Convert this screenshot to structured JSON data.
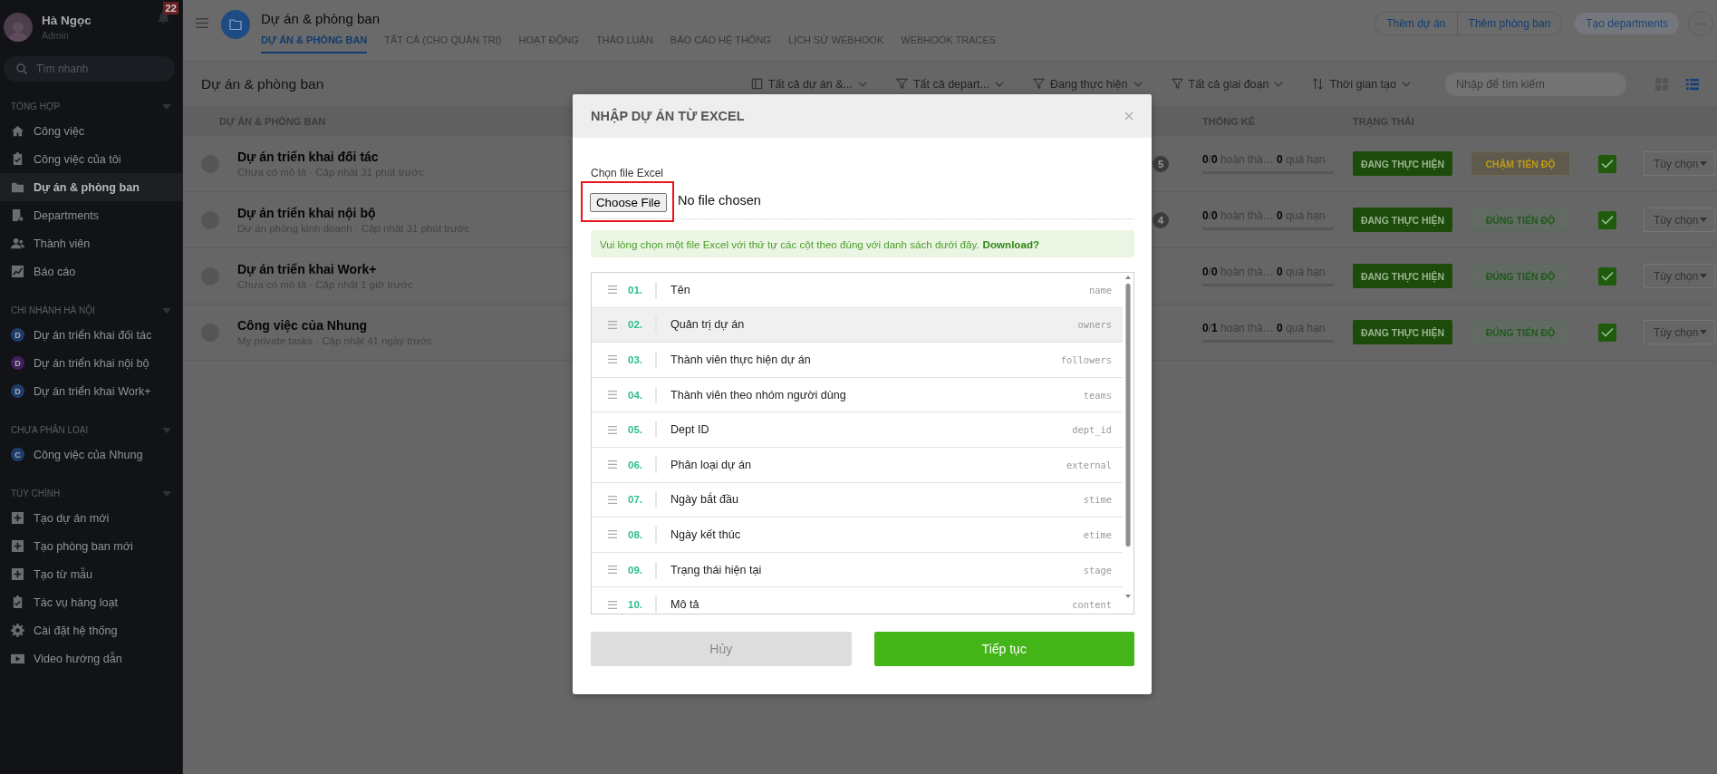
{
  "sidebar": {
    "user": {
      "name": "Hà Ngọc",
      "role": "Admin"
    },
    "notification_count": "22",
    "search": {
      "placeholder": "Tìm nhanh"
    },
    "sections": [
      {
        "title": "TỔNG HỢP",
        "expanded": true,
        "items": [
          {
            "label": "Công việc",
            "kind": "link",
            "selected": false
          },
          {
            "label": "Công việc của tôi",
            "kind": "link",
            "selected": false
          },
          {
            "label": "Dự án & phòng ban",
            "kind": "link",
            "selected": true
          },
          {
            "label": "Departments",
            "kind": "link",
            "selected": false
          },
          {
            "label": "Thành viên",
            "kind": "link",
            "selected": false
          },
          {
            "label": "Báo cáo",
            "kind": "link",
            "selected": false
          }
        ]
      },
      {
        "title": "CHI NHÁNH HÀ NỘI",
        "expanded": true,
        "items": [
          {
            "label": "Dự án triển khai đối tác",
            "kind": "project",
            "badge": "D",
            "color": "#1d3e6b",
            "selected": false
          },
          {
            "label": "Dự án triển khai nội bộ",
            "kind": "project",
            "badge": "D",
            "color": "#43205c",
            "selected": false
          },
          {
            "label": "Dự án triển khai Work+",
            "kind": "project",
            "badge": "D",
            "color": "#1d3e6b",
            "selected": false
          }
        ]
      },
      {
        "title": "CHƯA PHÂN LOẠI",
        "expanded": true,
        "items": [
          {
            "label": "Công việc của Nhung",
            "kind": "project",
            "badge": "C",
            "color": "#1d3e6b",
            "selected": false
          }
        ]
      },
      {
        "title": "TÙY CHỈNH",
        "expanded": true,
        "items": [
          {
            "label": "Tạo dự án mới",
            "kind": "link",
            "selected": false
          },
          {
            "label": "Tạo phòng ban mới",
            "kind": "link",
            "selected": false
          },
          {
            "label": "Tạo từ mẫu",
            "kind": "link",
            "selected": false
          },
          {
            "label": "Tác vụ hàng loạt",
            "kind": "link",
            "selected": false
          },
          {
            "label": "Cài đặt hệ thống",
            "kind": "link",
            "selected": false
          },
          {
            "label": "Video hướng dẫn",
            "kind": "link",
            "selected": false
          }
        ]
      }
    ]
  },
  "header": {
    "title": "Dự án & phòng ban",
    "tabs": [
      {
        "label": "DỰ ÁN & PHÒNG BAN",
        "selected": true
      },
      {
        "label": "TẤT CẢ (CHO QUẢN TRỊ)",
        "selected": false
      },
      {
        "label": "HOẠT ĐỘNG",
        "selected": false
      },
      {
        "label": "THẢO LUẬN",
        "selected": false
      },
      {
        "label": "BÁO CÁO HỆ THỐNG",
        "selected": false
      },
      {
        "label": "LỊCH SỬ WEBHOOK",
        "selected": false
      },
      {
        "label": "WEBHOOK TRACES",
        "selected": false
      }
    ],
    "actions": [
      {
        "label": "Thêm dự án",
        "kind": "outline"
      },
      {
        "label": "Thêm phòng ban",
        "kind": "outline"
      },
      {
        "label": "Tạo departments",
        "kind": "filled"
      }
    ]
  },
  "toolbar": {
    "title": "Dự án & phòng ban",
    "filters": [
      {
        "label": "Tất cả dự án &...",
        "kind": "view"
      },
      {
        "label": "Tất cả depart...",
        "kind": "filter"
      },
      {
        "label": "Đang thực hiện",
        "kind": "filter"
      },
      {
        "label": "Tất cả giai đoạn",
        "kind": "filter"
      },
      {
        "label": "Thời gian tạo",
        "kind": "sort"
      }
    ],
    "search": {
      "placeholder": "Nhập để tìm kiếm"
    },
    "view_modes": [
      {
        "kind": "grid",
        "selected": false
      },
      {
        "kind": "list",
        "selected": true
      }
    ]
  },
  "table": {
    "columns": [
      "DỰ ÁN & PHÒNG BAN",
      "THỐNG KÊ",
      "TRẠNG THÁI"
    ],
    "rows": [
      {
        "name": "Dự án triển khai đối tác",
        "subtitle": "Chưa có mô tả · Cập nhật 31 phút trước",
        "count": "5",
        "stats": "**0**/**0** hoàn thà… **0** quá hạn",
        "level": 0,
        "stage": "ĐANG THỰC HIỆN",
        "progress": {
          "label": "CHẬM TIẾN ĐỘ",
          "kind": "late"
        },
        "checked": true,
        "options": "Tùy chọn"
      },
      {
        "name": "Dự án triển khai nội bộ",
        "subtitle": "Dự án phòng kinh doanh · Cập nhật 31 phút trước",
        "count": "4",
        "stats": "**0**/**0** hoàn thà… **0** quá hạn",
        "level": 0,
        "stage": "ĐANG THỰC HIỆN",
        "progress": {
          "label": "ĐÚNG TIẾN ĐỘ",
          "kind": "on_time"
        },
        "checked": true,
        "options": "Tùy chọn"
      },
      {
        "name": "Dự án triển khai Work+",
        "subtitle": "Chưa có mô tả · Cập nhật 1 giờ trước",
        "stats": "**0**/**0** hoàn thà… **0** quá hạn",
        "level": 0,
        "stage": "ĐANG THỰC HIỆN",
        "progress": {
          "label": "ĐÚNG TIẾN ĐỘ",
          "kind": "on_time"
        },
        "checked": true,
        "options": "Tùy chọn"
      },
      {
        "name": "Công việc của Nhung",
        "subtitle": "My private tasks · Cập nhật 41 ngày trước",
        "stats": "**0**/**1** hoàn thà… **0** quá hạn",
        "level": 0,
        "stage": "ĐANG THỰC HIỆN",
        "progress": {
          "label": "ĐÚNG TIẾN ĐỘ",
          "kind": "on_time"
        },
        "checked": true,
        "options": "Tùy chọn"
      }
    ]
  },
  "modal": {
    "title": "NHẬP DỰ ÁN TỪ EXCEL",
    "file_label": "Chọn file Excel",
    "file_button": "Choose File",
    "file_status": "No file chosen",
    "file_highlighted": true,
    "notice": "Vui lòng chọn một file Excel với thứ tự các cột theo đúng với danh sách dưới đây.",
    "notice_link": "Download?",
    "columns": [
      {
        "index": "01.",
        "label": "Tên",
        "field": "name",
        "selected": false
      },
      {
        "index": "02.",
        "label": "Quản trị dự án",
        "field": "owners",
        "selected": true
      },
      {
        "index": "03.",
        "label": "Thành viên thực hiện dự án",
        "field": "followers",
        "selected": false
      },
      {
        "index": "04.",
        "label": "Thành viên theo nhóm người dùng",
        "field": "teams",
        "selected": false
      },
      {
        "index": "05.",
        "label": "Dept ID",
        "field": "dept_id",
        "selected": false
      },
      {
        "index": "06.",
        "label": "Phân loại dự án",
        "field": "external",
        "selected": false
      },
      {
        "index": "07.",
        "label": "Ngày bắt đầu",
        "field": "stime",
        "selected": false
      },
      {
        "index": "08.",
        "label": "Ngày kết thúc",
        "field": "etime",
        "selected": false
      },
      {
        "index": "09.",
        "label": "Trạng thái hiện tại",
        "field": "stage",
        "selected": false
      },
      {
        "index": "10.",
        "label": "Mô tả",
        "field": "content",
        "selected": false
      }
    ],
    "buttons": [
      {
        "label": "Hủy",
        "kind": "cancel"
      },
      {
        "label": "Tiếp tục",
        "kind": "primary"
      }
    ]
  }
}
